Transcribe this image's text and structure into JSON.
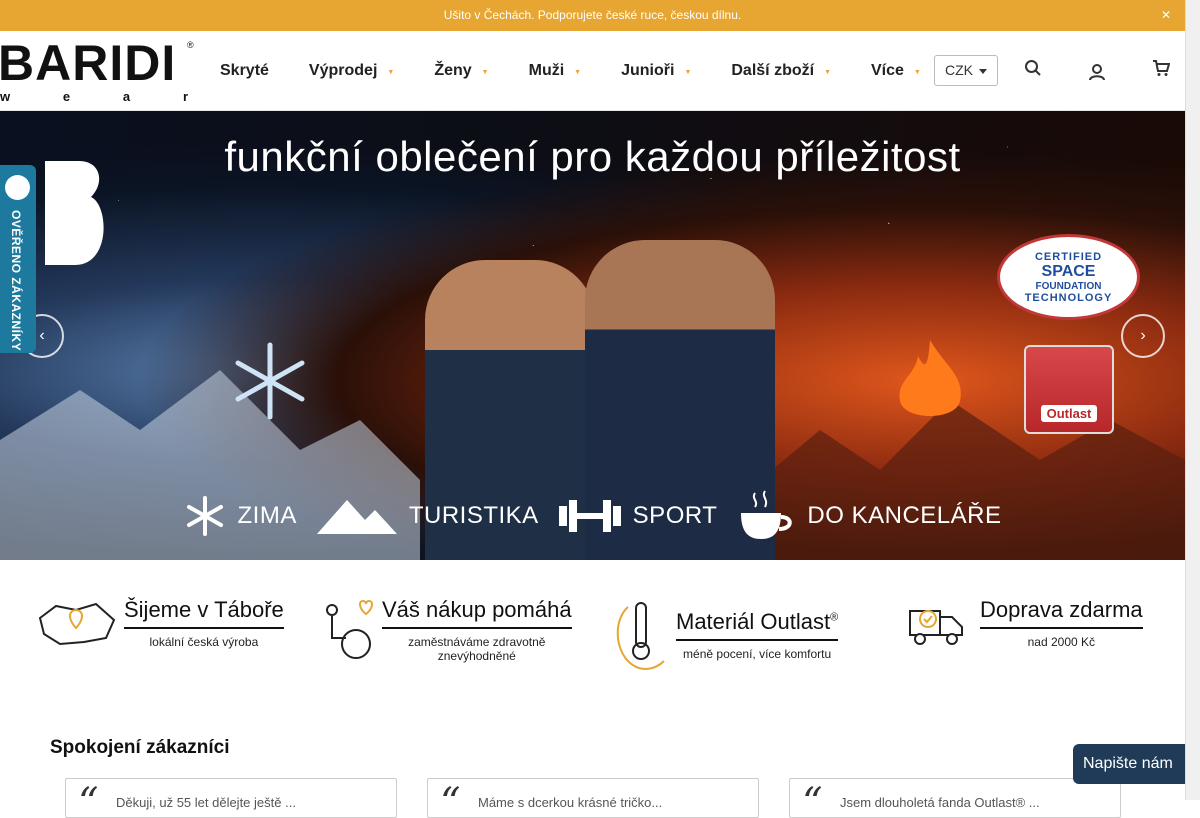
{
  "topbar": {
    "text": "Ušito v Čechách. Podporujete české ruce, českou dílnu.",
    "close_icon": "close-icon"
  },
  "logo": {
    "word": "BARIDI",
    "sub": [
      "w",
      "e",
      "a",
      "r"
    ],
    "reg": "®"
  },
  "nav": {
    "items": [
      {
        "label": "Skryté",
        "dropdown": false
      },
      {
        "label": "Výprodej",
        "dropdown": true
      },
      {
        "label": "Ženy",
        "dropdown": true
      },
      {
        "label": "Muži",
        "dropdown": true
      },
      {
        "label": "Junioři",
        "dropdown": true
      },
      {
        "label": "Další zboží",
        "dropdown": true
      },
      {
        "label": "Více",
        "dropdown": true
      }
    ],
    "currency": "CZK",
    "icons": [
      "search-icon",
      "user-icon",
      "cart-icon"
    ]
  },
  "side_tab": {
    "label": "OVĚŘENO ZÁKAZNÍKY"
  },
  "hero": {
    "title": "funkční oblečení pro každou příležitost",
    "badge_cert": [
      "CERTIFIED",
      "SPACE",
      "FOUNDATION",
      "TECHNOLOGY"
    ],
    "badge_outlast": "Outlast",
    "categories": [
      "ZIMA",
      "TURISTIKA",
      "SPORT",
      "DO KANCELÁŘE"
    ]
  },
  "usps": [
    {
      "title": "Šijeme v Táboře",
      "subtitle": "lokální česká výroba"
    },
    {
      "title": "Váš nákup pomáhá",
      "subtitle": "zaměstnáváme zdravotně znevýhodněné"
    },
    {
      "title": "Materiál Outlast",
      "reg": "®",
      "subtitle": "méně pocení, více komfortu"
    },
    {
      "title": "Doprava zdarma",
      "subtitle": "nad 2000 Kč"
    }
  ],
  "reviews": {
    "title": "Spokojení zákazníci",
    "items": [
      {
        "text": "Děkuji, už 55 let dělejte ještě ..."
      },
      {
        "text": "Máme s dcerkou krásné tričko..."
      },
      {
        "text": "Jsem dlouholetá fanda Outlast® ..."
      }
    ]
  },
  "chat": {
    "label": "Napište nám"
  }
}
